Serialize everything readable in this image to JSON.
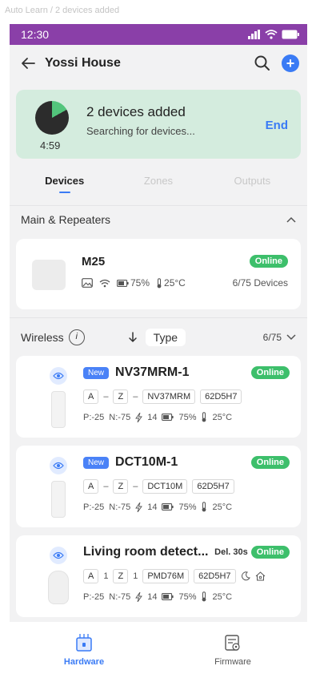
{
  "caption": "Auto Learn / 2 devices added",
  "status_bar": {
    "time": "12:30"
  },
  "header": {
    "title": "Yossi House"
  },
  "banner": {
    "timer": "4:59",
    "title": "2 devices added",
    "subtitle": "Searching for devices...",
    "end_label": "End",
    "progress_fraction": 0.17
  },
  "tabs": [
    {
      "label": "Devices"
    },
    {
      "label": "Zones"
    },
    {
      "label": "Outputs"
    }
  ],
  "main_section": {
    "title": "Main & Repeaters",
    "hub": {
      "name": "M25",
      "battery": "75%",
      "temp": "25°C",
      "status": "Online",
      "count": "6/75 Devices"
    }
  },
  "wireless": {
    "title": "Wireless",
    "info_symbol": "i",
    "sort_label": "Type",
    "count": "6/75",
    "devices": [
      {
        "tag": "New",
        "name": "NV37MRM-1",
        "status": "Online",
        "area": "A",
        "area_val": "–",
        "zone": "Z",
        "zone_val": "–",
        "model": "NV37MRM",
        "serial": "62D5H7",
        "p": "P:-25",
        "n": "N:-75",
        "signal": "14",
        "battery": "75%",
        "temp": "25°C"
      },
      {
        "tag": "New",
        "name": "DCT10M-1",
        "status": "Online",
        "area": "A",
        "area_val": "–",
        "zone": "Z",
        "zone_val": "–",
        "model": "DCT10M",
        "serial": "62D5H7",
        "p": "P:-25",
        "n": "N:-75",
        "signal": "14",
        "battery": "75%",
        "temp": "25°C"
      },
      {
        "name": "Living room detect...",
        "delay": "Del. 30s",
        "status": "Online",
        "area": "A",
        "area_val": "1",
        "zone": "Z",
        "zone_val": "1",
        "model": "PMD76M",
        "serial": "62D5H7",
        "p": "P:-25",
        "n": "N:-75",
        "signal": "14",
        "battery": "75%",
        "temp": "25°C"
      }
    ]
  },
  "bottom_nav": [
    {
      "label": "Hardware"
    },
    {
      "label": "Firmware"
    }
  ],
  "colors": {
    "accent": "#3a7bf5",
    "online": "#3dbf6b",
    "status_bar": "#8a3fa8",
    "banner": "#d4ecde"
  }
}
